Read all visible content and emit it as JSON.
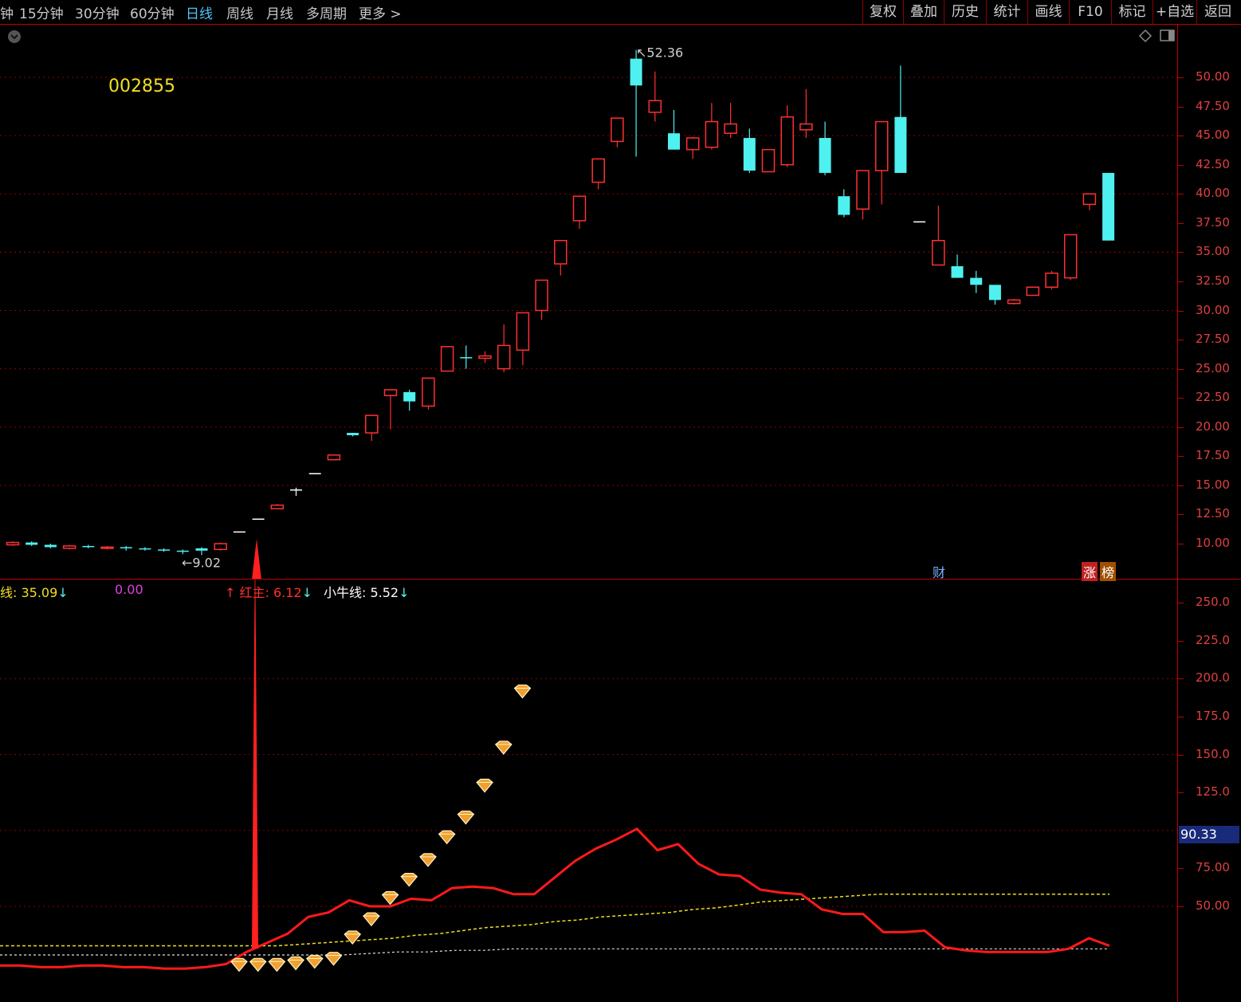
{
  "toolbar": {
    "periods": [
      "钟",
      "15分钟",
      "30分钟",
      "60分钟",
      "日线",
      "周线",
      "月线",
      "多周期",
      "更多"
    ],
    "active_index": 4,
    "more_arrow": ">",
    "right_buttons": [
      "复权",
      "叠加",
      "历史",
      "统计",
      "画线",
      "F10",
      "标记",
      "+自选",
      "返回"
    ]
  },
  "stock": {
    "code": "002855"
  },
  "price_chart": {
    "high_marker": "52.36",
    "low_marker": "9.02",
    "y_labels": [
      "50.00",
      "47.50",
      "45.00",
      "42.50",
      "40.00",
      "37.50",
      "35.00",
      "32.50",
      "30.00",
      "27.50",
      "25.00",
      "22.50",
      "20.00",
      "17.50",
      "15.00",
      "12.50",
      "10.00"
    ],
    "badges": {
      "cai": "财",
      "zhang": "涨",
      "bang": "榜"
    }
  },
  "indicator": {
    "legend": {
      "line1": "线: 35.09",
      "line2": "0.00",
      "line3": "红主: 6.12",
      "line4": "小牛线: 5.52"
    },
    "y_labels": [
      "250.0",
      "225.0",
      "200.0",
      "175.0",
      "150.0",
      "125.0",
      "75.00",
      "50.00"
    ],
    "current_value": "90.33"
  },
  "colors": {
    "up": "#ff3030",
    "down": "#4ff0f0",
    "grid": "#8b0000",
    "axis": "#c00000",
    "indicator_main": "#ff1a1a",
    "ma_yellow": "#e8e020",
    "ma_white": "#e0e0e0",
    "gem": "#f0a030"
  },
  "chart_data": {
    "type": "candlestick",
    "title": "002855",
    "ylim": [
      9,
      52.5
    ],
    "candles": [
      {
        "o": 9.9,
        "c": 10.1,
        "h": 10.2,
        "l": 9.8,
        "up": true
      },
      {
        "o": 10.1,
        "c": 9.9,
        "h": 10.2,
        "l": 9.8,
        "up": false
      },
      {
        "o": 9.9,
        "c": 9.7,
        "h": 10.0,
        "l": 9.6,
        "up": false
      },
      {
        "o": 9.6,
        "c": 9.8,
        "h": 9.9,
        "l": 9.5,
        "up": true
      },
      {
        "o": 9.8,
        "c": 9.7,
        "h": 9.9,
        "l": 9.6,
        "up": false
      },
      {
        "o": 9.6,
        "c": 9.7,
        "h": 9.8,
        "l": 9.5,
        "up": true
      },
      {
        "o": 9.7,
        "c": 9.6,
        "h": 9.8,
        "l": 9.4,
        "up": false
      },
      {
        "o": 9.6,
        "c": 9.5,
        "h": 9.7,
        "l": 9.4,
        "up": false
      },
      {
        "o": 9.5,
        "c": 9.4,
        "h": 9.6,
        "l": 9.3,
        "up": false
      },
      {
        "o": 9.4,
        "c": 9.3,
        "h": 9.5,
        "l": 9.1,
        "up": false
      },
      {
        "o": 9.4,
        "c": 9.6,
        "h": 9.7,
        "l": 9.02,
        "up": false
      },
      {
        "o": 9.5,
        "c": 10.0,
        "h": 10.1,
        "l": 9.4,
        "up": true
      },
      {
        "o": 11.0,
        "c": 11.0,
        "h": 11.0,
        "l": 11.0,
        "flat": true
      },
      {
        "o": 12.1,
        "c": 12.1,
        "h": 12.1,
        "l": 12.1,
        "flat": true
      },
      {
        "o": 13.0,
        "c": 13.3,
        "h": 13.4,
        "l": 13.0,
        "up": true
      },
      {
        "o": 14.6,
        "c": 14.6,
        "h": 14.8,
        "l": 14.1,
        "flat": true
      },
      {
        "o": 16.0,
        "c": 16.0,
        "h": 16.0,
        "l": 16.0,
        "flat": true
      },
      {
        "o": 17.2,
        "c": 17.6,
        "h": 17.6,
        "l": 17.2,
        "up": true
      },
      {
        "o": 19.5,
        "c": 19.3,
        "h": 19.5,
        "l": 19.2,
        "up": false
      },
      {
        "o": 19.5,
        "c": 21.0,
        "h": 21.0,
        "l": 18.8,
        "up": true
      },
      {
        "o": 22.7,
        "c": 23.2,
        "h": 23.2,
        "l": 19.8,
        "up": true
      },
      {
        "o": 23.0,
        "c": 22.2,
        "h": 23.2,
        "l": 21.4,
        "up": false
      },
      {
        "o": 21.8,
        "c": 24.2,
        "h": 24.2,
        "l": 21.5,
        "up": true
      },
      {
        "o": 24.8,
        "c": 26.9,
        "h": 26.9,
        "l": 24.8,
        "up": true
      },
      {
        "o": 26.0,
        "c": 25.9,
        "h": 27.0,
        "l": 25.0,
        "up": false
      },
      {
        "o": 25.9,
        "c": 26.1,
        "h": 26.5,
        "l": 25.5,
        "up": true
      },
      {
        "o": 25.0,
        "c": 27.0,
        "h": 28.8,
        "l": 24.7,
        "up": true
      },
      {
        "o": 26.6,
        "c": 29.8,
        "h": 29.8,
        "l": 25.3,
        "up": true
      },
      {
        "o": 30.0,
        "c": 32.6,
        "h": 32.6,
        "l": 29.2,
        "up": true
      },
      {
        "o": 34.0,
        "c": 36.0,
        "h": 36.0,
        "l": 33.0,
        "up": true
      },
      {
        "o": 37.7,
        "c": 39.8,
        "h": 39.8,
        "l": 37.0,
        "up": true
      },
      {
        "o": 41.0,
        "c": 43.0,
        "h": 43.0,
        "l": 40.4,
        "up": true
      },
      {
        "o": 44.5,
        "c": 46.5,
        "h": 46.5,
        "l": 44.0,
        "up": true
      },
      {
        "o": 49.3,
        "c": 51.6,
        "h": 52.36,
        "l": 43.2,
        "up": false
      },
      {
        "o": 47.0,
        "c": 48.0,
        "h": 50.5,
        "l": 46.2,
        "up": true
      },
      {
        "o": 45.2,
        "c": 43.8,
        "h": 47.2,
        "l": 43.8,
        "up": false
      },
      {
        "o": 43.8,
        "c": 44.8,
        "h": 44.9,
        "l": 43.0,
        "up": true
      },
      {
        "o": 44.0,
        "c": 46.2,
        "h": 47.8,
        "l": 43.8,
        "up": true
      },
      {
        "o": 45.2,
        "c": 46.0,
        "h": 47.8,
        "l": 44.8,
        "up": true
      },
      {
        "o": 44.8,
        "c": 42.0,
        "h": 45.6,
        "l": 41.8,
        "up": false
      },
      {
        "o": 41.9,
        "c": 43.8,
        "h": 43.8,
        "l": 41.9,
        "up": true
      },
      {
        "o": 42.5,
        "c": 46.6,
        "h": 47.6,
        "l": 42.3,
        "up": true
      },
      {
        "o": 45.5,
        "c": 46.0,
        "h": 49.0,
        "l": 44.8,
        "up": true
      },
      {
        "o": 44.8,
        "c": 41.8,
        "h": 46.2,
        "l": 41.6,
        "up": false
      },
      {
        "o": 39.8,
        "c": 38.2,
        "h": 40.4,
        "l": 38.0,
        "up": false
      },
      {
        "o": 38.7,
        "c": 42.0,
        "h": 42.0,
        "l": 37.8,
        "up": true
      },
      {
        "o": 42.0,
        "c": 46.2,
        "h": 46.2,
        "l": 39.1,
        "up": true
      },
      {
        "o": 46.6,
        "c": 41.8,
        "h": 51.0,
        "l": 41.8,
        "up": false
      },
      {
        "o": 37.6,
        "c": 37.6,
        "h": 37.6,
        "l": 37.6,
        "flat": true
      },
      {
        "o": 33.9,
        "c": 36.0,
        "h": 39.0,
        "l": 33.9,
        "up": true
      },
      {
        "o": 33.8,
        "c": 32.8,
        "h": 34.8,
        "l": 32.8,
        "up": false
      },
      {
        "o": 32.8,
        "c": 32.2,
        "h": 33.4,
        "l": 31.5,
        "up": false
      },
      {
        "o": 32.2,
        "c": 30.9,
        "h": 32.2,
        "l": 30.5,
        "up": false
      },
      {
        "o": 30.6,
        "c": 30.9,
        "h": 31.0,
        "l": 30.5,
        "up": true
      },
      {
        "o": 31.3,
        "c": 32.0,
        "h": 32.0,
        "l": 31.3,
        "up": true
      },
      {
        "o": 32.0,
        "c": 33.2,
        "h": 33.4,
        "l": 31.8,
        "up": true
      },
      {
        "o": 32.8,
        "c": 36.5,
        "h": 36.5,
        "l": 32.6,
        "up": true
      },
      {
        "o": 39.1,
        "c": 40.0,
        "h": 40.0,
        "l": 38.6,
        "up": true
      },
      {
        "o": 41.8,
        "c": 36.0,
        "h": 41.8,
        "l": 36.0,
        "up": false
      }
    ],
    "indicator": {
      "ylim": [
        20,
        262
      ],
      "main": [
        11,
        11,
        10,
        10,
        11,
        11,
        10,
        10,
        9,
        9,
        10,
        12,
        20,
        26,
        32,
        43,
        46,
        54,
        50,
        50,
        55,
        54,
        62,
        63,
        62,
        58,
        58,
        69,
        80,
        88,
        94,
        101,
        87,
        91,
        78,
        71,
        70,
        61,
        59,
        58,
        48,
        45,
        45,
        33,
        33,
        34,
        23,
        21,
        20,
        20,
        20,
        20,
        22,
        29,
        24
      ],
      "ma_yellow": [
        24,
        24,
        24,
        24,
        24,
        24,
        24,
        24,
        24,
        24,
        24,
        24,
        24,
        25,
        26,
        27,
        28,
        29,
        31,
        32,
        34,
        36,
        37,
        38,
        40,
        41,
        43,
        44,
        45,
        46,
        48,
        49,
        51,
        53,
        54,
        55,
        56,
        57,
        58,
        58,
        58,
        58,
        58,
        58,
        58,
        58,
        58,
        58,
        58
      ],
      "ma_white": [
        18,
        18,
        18,
        18,
        18,
        18,
        18,
        18,
        18,
        18,
        18,
        18,
        18,
        19,
        20,
        20,
        21,
        21,
        22,
        22,
        22,
        22,
        22,
        22,
        22,
        22,
        22,
        22,
        22,
        22,
        22,
        22,
        22,
        22,
        22,
        22,
        22,
        22,
        22,
        22
      ],
      "gems": [
        11,
        11,
        11,
        12,
        13,
        15,
        29,
        41,
        55,
        67,
        80,
        95,
        108,
        129,
        154,
        191
      ]
    }
  }
}
